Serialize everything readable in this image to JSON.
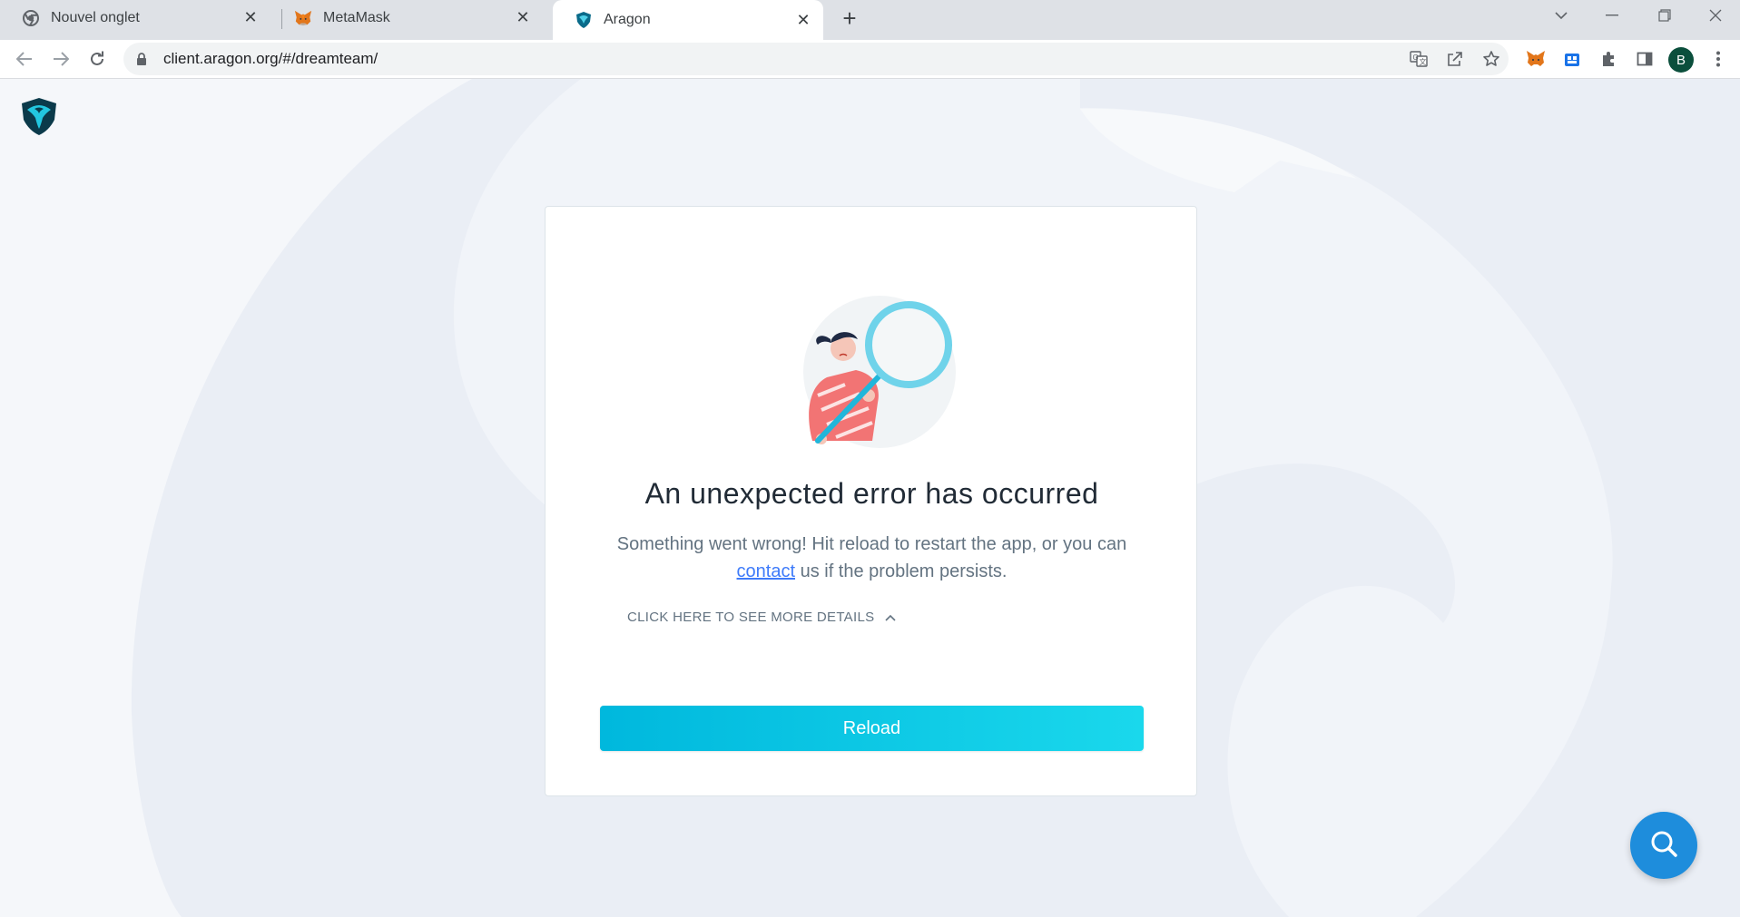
{
  "browser": {
    "tabs": [
      {
        "title": "Nouvel onglet",
        "icon": "chrome-icon",
        "active": false
      },
      {
        "title": "MetaMask",
        "icon": "metamask-fox-icon",
        "active": false
      },
      {
        "title": "Aragon",
        "icon": "aragon-icon",
        "active": true
      }
    ],
    "url": "client.aragon.org/#/dreamteam/",
    "profile_initial": "B"
  },
  "error": {
    "title": "An unexpected error has occurred",
    "message_before": "Something went wrong! Hit reload to restart the app, or you can",
    "link_text": "contact",
    "message_after": " us if the problem persists.",
    "details_label": "CLICK HERE TO SEE MORE DETAILS",
    "reload_label": "Reload"
  },
  "colors": {
    "accent": "#00b8dd",
    "fab": "#1e8ddc",
    "link": "#3e7bfa"
  }
}
